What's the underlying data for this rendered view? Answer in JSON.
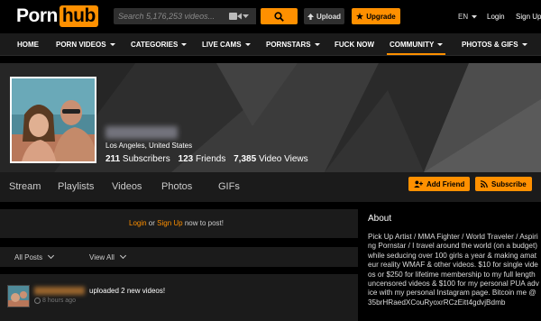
{
  "header": {
    "logo_part1": "Porn",
    "logo_part2": "hub",
    "search_placeholder": "Search 5,176,253 videos...",
    "upload_label": "Upload",
    "upgrade_label": "Upgrade",
    "language": "EN",
    "login_label": "Login",
    "signup_label": "Sign Up"
  },
  "nav": {
    "items": [
      {
        "label": "HOME",
        "dropdown": false
      },
      {
        "label": "PORN VIDEOS",
        "dropdown": true
      },
      {
        "label": "CATEGORIES",
        "dropdown": true
      },
      {
        "label": "LIVE CAMS",
        "dropdown": true
      },
      {
        "label": "PORNSTARS",
        "dropdown": true
      },
      {
        "label": "FUCK NOW",
        "dropdown": false
      },
      {
        "label": "COMMUNITY",
        "dropdown": true,
        "active": true
      },
      {
        "label": "PHOTOS & GIFS",
        "dropdown": true
      }
    ]
  },
  "profile": {
    "location": "Los Angeles, United States",
    "subscribers_count": "211",
    "subscribers_label": "Subscribers",
    "friends_count": "123",
    "friends_label": "Friends",
    "views_count": "7,385",
    "views_label": "Video Views"
  },
  "tabs": [
    "Stream",
    "Playlists",
    "Videos",
    "Photos",
    "GIFs"
  ],
  "actions": {
    "add_friend": "Add Friend",
    "subscribe": "Subscribe"
  },
  "post_prompt": {
    "login": "Login",
    "or": " or ",
    "signup": "Sign Up",
    "rest": " now to post!"
  },
  "filters": {
    "all_posts": "All Posts",
    "view_all": "View All"
  },
  "feed": {
    "action": "uploaded 2 new videos!",
    "time": "8 hours ago"
  },
  "about": {
    "title": "About",
    "text": "Pick Up Artist / MMA Fighter / World Traveler / Aspiring Pornstar / I travel around the world (on a budget) while seducing over 100 girls a year & making amateur reality WMAF & other videos. $10 for single videos or $250 for lifetime membership to my full length uncensored videos & $100 for my personal PUA advice with my personal Instagram page. Bitcoin me @ 35brHRaedXCouRyoxrRCzEitt4gdvjBdmb"
  },
  "colors": {
    "accent": "#ff9000",
    "background": "#000000",
    "panel": "#1b1b1b"
  }
}
